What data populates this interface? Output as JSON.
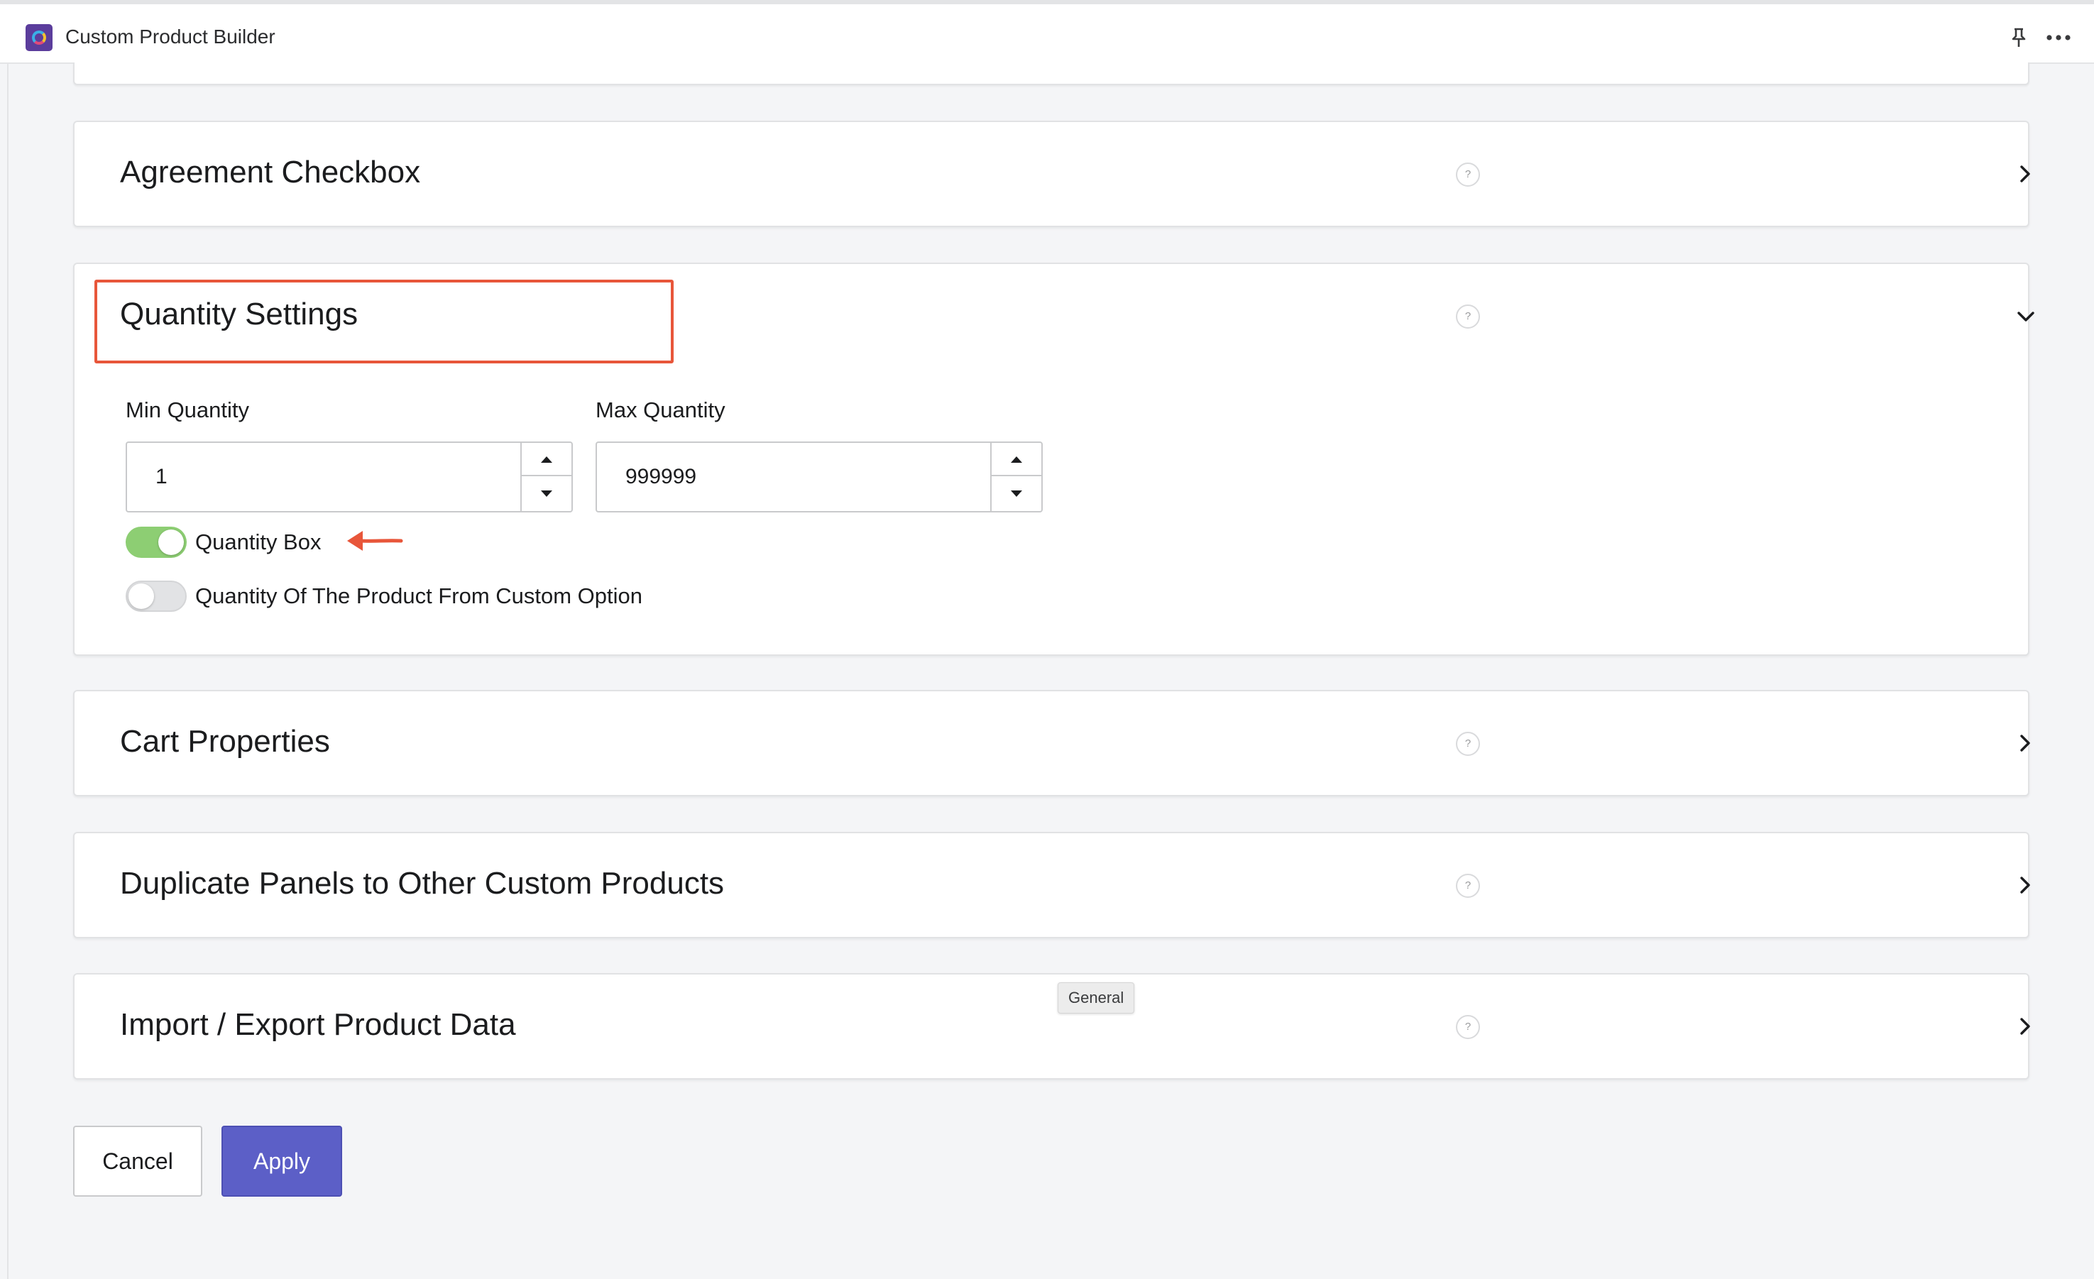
{
  "app": {
    "title": "Custom Product Builder",
    "icon": "app-logo"
  },
  "header": {
    "pin_icon": "pin-icon",
    "more_icon": "more-options-icon"
  },
  "panels": [
    {
      "title": "Agreement Checkbox",
      "expanded": false
    },
    {
      "title": "Quantity Settings",
      "expanded": true
    },
    {
      "title": "Cart Properties",
      "expanded": false
    },
    {
      "title": "Duplicate Panels to Other Custom Products",
      "expanded": false
    },
    {
      "title": "Import / Export Product Data",
      "expanded": false
    }
  ],
  "help_glyph": "?",
  "quantity": {
    "min_label": "Min Quantity",
    "min_value": "1",
    "max_label": "Max Quantity",
    "max_value": "999999",
    "toggles": [
      {
        "label": "Quantity Box",
        "on": true
      },
      {
        "label": "Quantity Of The Product From Custom Option",
        "on": false
      }
    ]
  },
  "tooltip": "General",
  "actions": {
    "cancel_label": "Cancel",
    "apply_label": "Apply"
  },
  "colors": {
    "accent": "#5c5fc7",
    "toggle_on": "#8dce73",
    "annotation": "#e8563a"
  }
}
